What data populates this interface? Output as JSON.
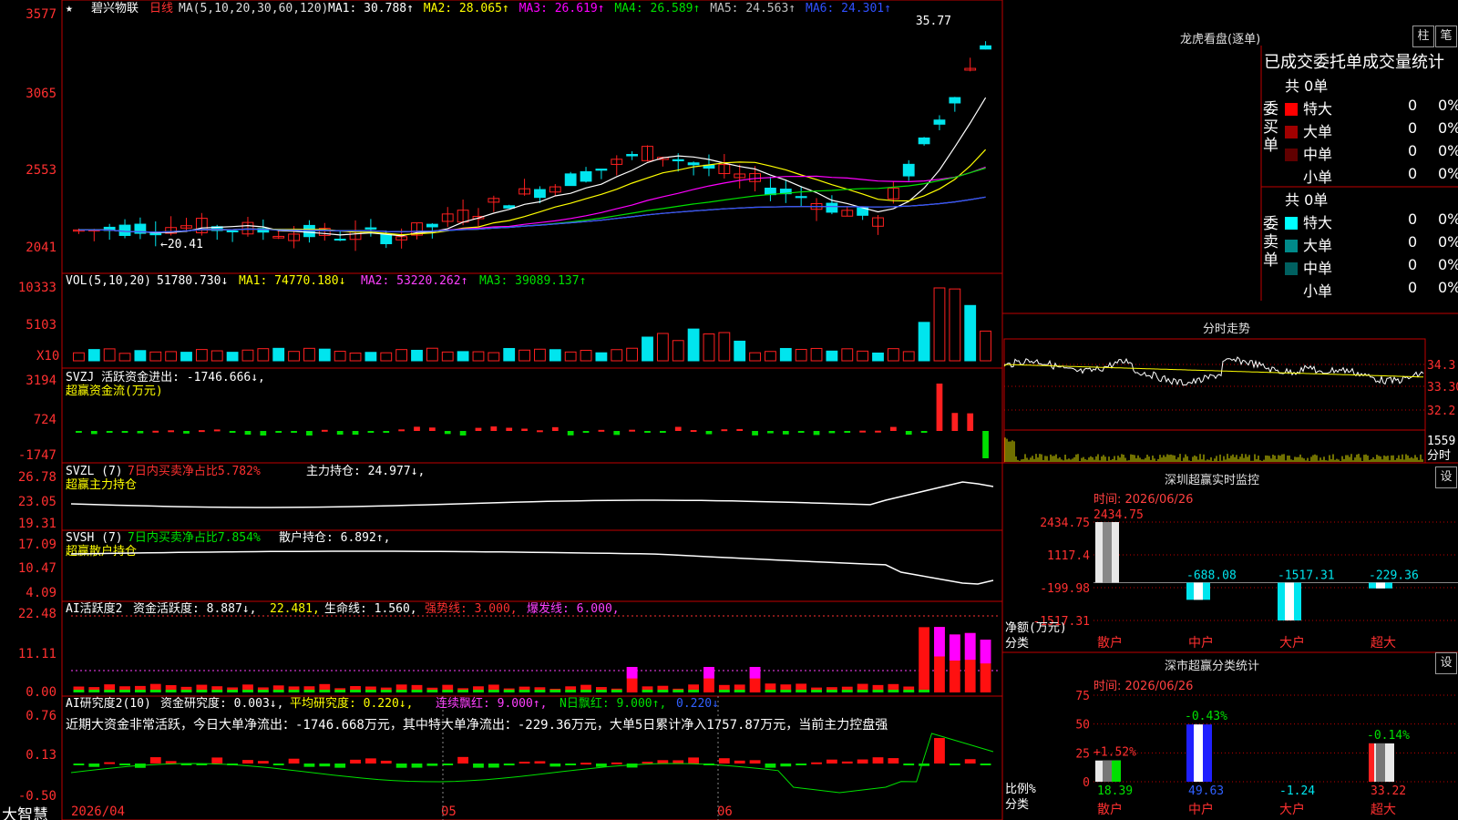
{
  "app": {
    "name": "大智慧"
  },
  "stock": {
    "name": "碧兴物联",
    "period": "日线",
    "ma_label": "MA(5,10,20,30,60,120)",
    "ma": [
      {
        "label": "MA1: 30.788",
        "color": "#ffffff"
      },
      {
        "label": "MA2: 28.065",
        "color": "#ffff00"
      },
      {
        "label": "MA3: 26.619",
        "color": "#ff00ff"
      },
      {
        "label": "MA4: 26.589",
        "color": "#00e000"
      },
      {
        "label": "MA5: 24.563",
        "color": "#c0c0c0"
      },
      {
        "label": "MA6: 24.301",
        "color": "#3050ff"
      }
    ],
    "high_mark": "35.77",
    "low_mark": "20.41"
  },
  "price_axis": [
    "3577",
    "3065",
    "2553",
    "2041"
  ],
  "vol": {
    "label": "VOL(5,10,20)",
    "value": "51780.730",
    "ma1": "MA1: 74770.180",
    "ma2": "MA2: 53220.262",
    "ma3": "MA3: 39089.137",
    "axis": [
      "10333",
      "5103"
    ],
    "unit": "X10"
  },
  "svzj": {
    "label": "SVZJ  活跃资金进出: -1746.666",
    "sub": "超赢资金流(万元)",
    "axis": [
      "3194",
      "724",
      "-1747"
    ]
  },
  "svzl": {
    "label": "SVZL (7)",
    "pct": "7日内买卖净占比5.782%",
    "hold": "主力持仓: 24.977",
    "sub": "超赢主力持仓",
    "axis": [
      "26.78",
      "23.05",
      "19.31"
    ]
  },
  "svsh": {
    "label": "SVSH (7)",
    "pct": "7日内买卖净占比7.854%",
    "hold": "散户持仓: 6.892",
    "sub": "超赢散户持仓",
    "axis": [
      "17.09",
      "10.47",
      "4.09"
    ]
  },
  "ai1": {
    "label": "AI活跃度2",
    "v1": "资金活跃度: 8.887",
    "v2": "22.481",
    "v3": "生命线: 1.560",
    "v4": "强势线: 3.000",
    "v5": "爆发线: 6.000",
    "axis": [
      "22.48",
      "11.11",
      "0.00"
    ]
  },
  "ai2": {
    "label": "AI研究度2(10)",
    "v1": "资金研究度: 0.003",
    "v2": "平均研究度: 0.220",
    "v3": "连续飘红: 9.000",
    "v4": "N日飘红: 9.000",
    "v5": "0.220",
    "desc": "近期大资金非常活跃，今日大单净流出：-1746.668万元，其中特大单净流出：-229.36万元，大单5日累计净入1757.87万元，当前主力控盘强",
    "axis": [
      "0.76",
      "0.13",
      "-0.50"
    ]
  },
  "dates": [
    "2026/04",
    "05",
    "06"
  ],
  "lhb": {
    "title": "龙虎看盘(逐单)",
    "tab1": "柱",
    "tab2": "笔",
    "header": "已成交委托单成交量统计",
    "buy": {
      "side": "委买单",
      "total": "共 0单",
      "rows": [
        {
          "name": "特大",
          "n": "0",
          "p": "0%",
          "color": "#ff0000"
        },
        {
          "name": "大单",
          "n": "0",
          "p": "0%",
          "color": "#a00000"
        },
        {
          "name": "中单",
          "n": "0",
          "p": "0%",
          "color": "#600000"
        },
        {
          "name": "小单",
          "n": "0",
          "p": "0%",
          "color": "#000000"
        }
      ]
    },
    "sell": {
      "side": "委卖单",
      "total": "共 0单",
      "rows": [
        {
          "name": "特大",
          "n": "0",
          "p": "0%",
          "color": "#00ffff"
        },
        {
          "name": "大单",
          "n": "0",
          "p": "0%",
          "color": "#008a8a"
        },
        {
          "name": "中单",
          "n": "0",
          "p": "0%",
          "color": "#006060"
        },
        {
          "name": "小单",
          "n": "0",
          "p": "0%",
          "color": "#000000"
        }
      ]
    }
  },
  "intraday": {
    "title": "分时走势",
    "price_labels": [
      "34.3",
      "33.30",
      "32.2"
    ],
    "vol_label": "1559",
    "unit": "分时"
  },
  "sz_monitor": {
    "title": "深圳超赢实时监控",
    "time": "时间: 2026/06/26",
    "btn": "设",
    "axis": [
      "2434.75",
      "1117.4",
      "-199.98",
      "-1517.31"
    ],
    "ylabel": "净额(万元)",
    "xlabel": "分类",
    "cats": [
      "散户",
      "中户",
      "大户",
      "超大"
    ],
    "values": [
      "2434.75",
      "-688.08",
      "-1517.31",
      "-229.36"
    ]
  },
  "sz_class": {
    "title": "深市超赢分类统计",
    "time": "时间: 2026/06/26",
    "btn": "设",
    "axis": [
      "75",
      "50",
      "25",
      "0"
    ],
    "ylabel": "比例%",
    "xlabel": "分类",
    "cats": [
      "散户",
      "中户",
      "大户",
      "超大"
    ],
    "top": [
      "+1.52%",
      "-0.43%",
      "",
      "-0.14%"
    ],
    "bottom": [
      "18.39",
      "49.63",
      "-1.24",
      "33.22"
    ]
  }
}
